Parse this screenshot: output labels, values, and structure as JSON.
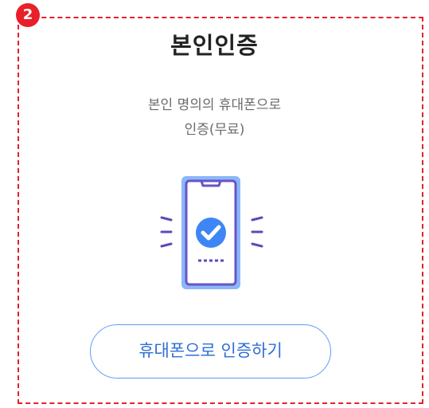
{
  "step": {
    "number": "2"
  },
  "card": {
    "title": "본인인증",
    "description_line1": "본인 명의의 휴대폰으로",
    "description_line2": "인증(무료)",
    "button_label": "휴대폰으로 인증하기"
  },
  "illustration": {
    "icon": "phone-verified-icon",
    "colors": {
      "frame_outer": "#8ab8f8",
      "frame_inner": "#6a52c9",
      "check": "#3e86f5",
      "waves": "#5b4bb8"
    }
  },
  "colors": {
    "dashed_border": "#e8202a",
    "badge": "#e8202a",
    "button_border": "#5b9ef5",
    "button_text": "#2f6fd6"
  }
}
